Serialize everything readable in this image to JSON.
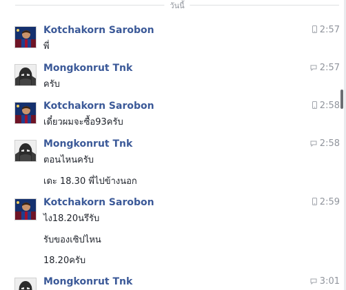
{
  "divider": {
    "label": "วันนี้"
  },
  "messages": [
    {
      "sender": "Kotchakorn Sarobon",
      "time": "2:57",
      "device": "mobile-icon",
      "avatar": "messi",
      "lines": [
        "พี่"
      ]
    },
    {
      "sender": "Mongkonrut Tnk",
      "time": "2:57",
      "device": "chat-icon",
      "avatar": "ironman",
      "lines": [
        "ครับ"
      ]
    },
    {
      "sender": "Kotchakorn Sarobon",
      "time": "2:58",
      "device": "mobile-icon",
      "avatar": "messi",
      "lines": [
        "เดี๋ยวผมจะซื้อ93ครับ"
      ]
    },
    {
      "sender": "Mongkonrut Tnk",
      "time": "2:58",
      "device": "chat-icon",
      "avatar": "ironman",
      "lines": [
        "ตอนไหนครับ",
        "เดะ 18.30 พี่ไปข้างนอก"
      ]
    },
    {
      "sender": "Kotchakorn Sarobon",
      "time": "2:59",
      "device": "mobile-icon",
      "avatar": "messi",
      "lines": [
        "ไง18.20นรึรับ",
        "รับของเซิปไหน",
        "18.20ครับ"
      ]
    },
    {
      "sender": "Mongkonrut Tnk",
      "time": "3:01",
      "device": "chat-icon",
      "avatar": "ironman",
      "lines": []
    }
  ],
  "colors": {
    "sender": "#3b5998",
    "time": "#90949c",
    "text": "#1d2129",
    "divider": "#dddfe2"
  }
}
